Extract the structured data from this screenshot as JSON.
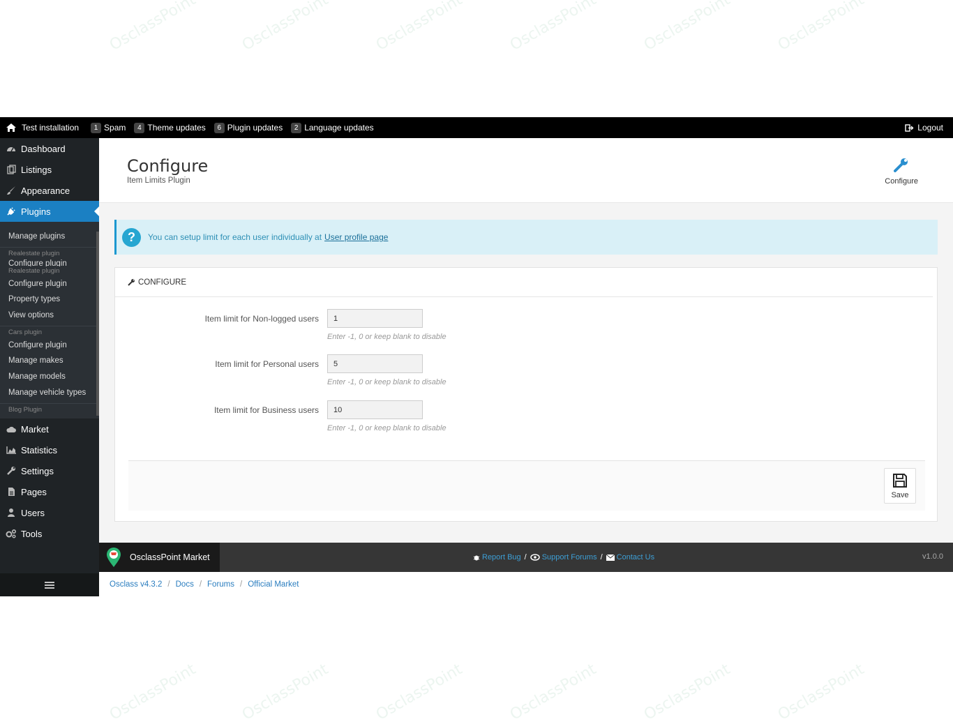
{
  "topbar": {
    "home_label": "Test installation",
    "items": [
      {
        "count": "1",
        "label": "Spam"
      },
      {
        "count": "4",
        "label": "Theme updates"
      },
      {
        "count": "6",
        "label": "Plugin updates"
      },
      {
        "count": "2",
        "label": "Language updates"
      }
    ],
    "logout_label": "Logout"
  },
  "sidebar": {
    "nav_top": [
      {
        "label": "Dashboard",
        "icon": "dashboard-icon"
      },
      {
        "label": "Listings",
        "icon": "listings-icon"
      },
      {
        "label": "Appearance",
        "icon": "brush-icon"
      },
      {
        "label": "Plugins",
        "icon": "plug-icon"
      }
    ],
    "submenu": {
      "manage_plugins": "Manage plugins",
      "realestate_group_1": "Realestate plugin",
      "configure_plugin_partial": "Configure plugin",
      "realestate_group_2": "Realestate plugin",
      "configure_plugin": "Configure plugin",
      "property_types": "Property types",
      "view_options": "View options",
      "cars_group": "Cars plugin",
      "cars_configure": "Configure plugin",
      "manage_makes": "Manage makes",
      "manage_models": "Manage models",
      "manage_vehicle_types": "Manage vehicle types",
      "blog_group": "Blog Plugin"
    },
    "nav_bottom": [
      {
        "label": "Market",
        "icon": "market-icon"
      },
      {
        "label": "Statistics",
        "icon": "statistics-icon"
      },
      {
        "label": "Settings",
        "icon": "wrench-icon"
      },
      {
        "label": "Pages",
        "icon": "pages-icon"
      },
      {
        "label": "Users",
        "icon": "user-icon"
      },
      {
        "label": "Tools",
        "icon": "tools-icon"
      }
    ]
  },
  "header": {
    "title": "Configure",
    "subtitle": "Item Limits Plugin",
    "configure_button": "Configure"
  },
  "alert": {
    "text": "You can setup limit for each user individually at",
    "link": "User profile page"
  },
  "panel": {
    "heading": "CONFIGURE",
    "fields": [
      {
        "label": "Item limit for Non-logged users",
        "value": "1",
        "hint": "Enter -1, 0 or keep blank to disable"
      },
      {
        "label": "Item limit for Personal users",
        "value": "5",
        "hint": "Enter -1, 0 or keep blank to disable"
      },
      {
        "label": "Item limit for Business users",
        "value": "10",
        "hint": "Enter -1, 0 or keep blank to disable"
      }
    ],
    "save_label": "Save"
  },
  "footer": {
    "brand": "OsclassPoint Market",
    "report_bug": "Report Bug",
    "support_forums": "Support Forums",
    "contact_us": "Contact Us",
    "separator": "/",
    "version": "v1.0.0"
  },
  "bottom_links": {
    "osclass": "Osclass v4.3.2",
    "docs": "Docs",
    "forums": "Forums",
    "official_market": "Official Market",
    "separator": "/"
  },
  "watermark": "OsclassPoint",
  "colors": {
    "active_nav": "#1b80c3",
    "sidebar_bg": "#1f2326",
    "alert_bg": "#d9f0f7",
    "link": "#2a7dbf"
  }
}
